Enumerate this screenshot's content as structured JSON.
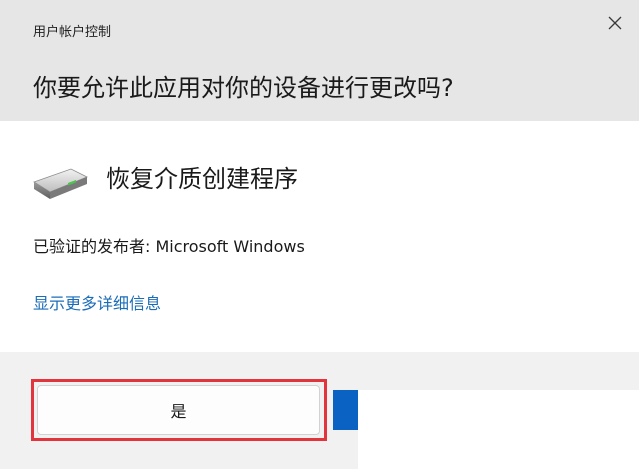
{
  "window": {
    "title": "用户帐户控制",
    "close_icon": "close-icon"
  },
  "prompt": {
    "question": "你要允许此应用对你的设备进行更改吗?"
  },
  "app": {
    "icon": "drive-icon",
    "name": "恢复介质创建程序",
    "publisher": "已验证的发布者: Microsoft Windows",
    "details_link": "显示更多详细信息"
  },
  "buttons": {
    "yes_label": "是",
    "accent_color": "#0a63c2"
  },
  "annotation": {
    "highlight_color": "#e2343c"
  }
}
